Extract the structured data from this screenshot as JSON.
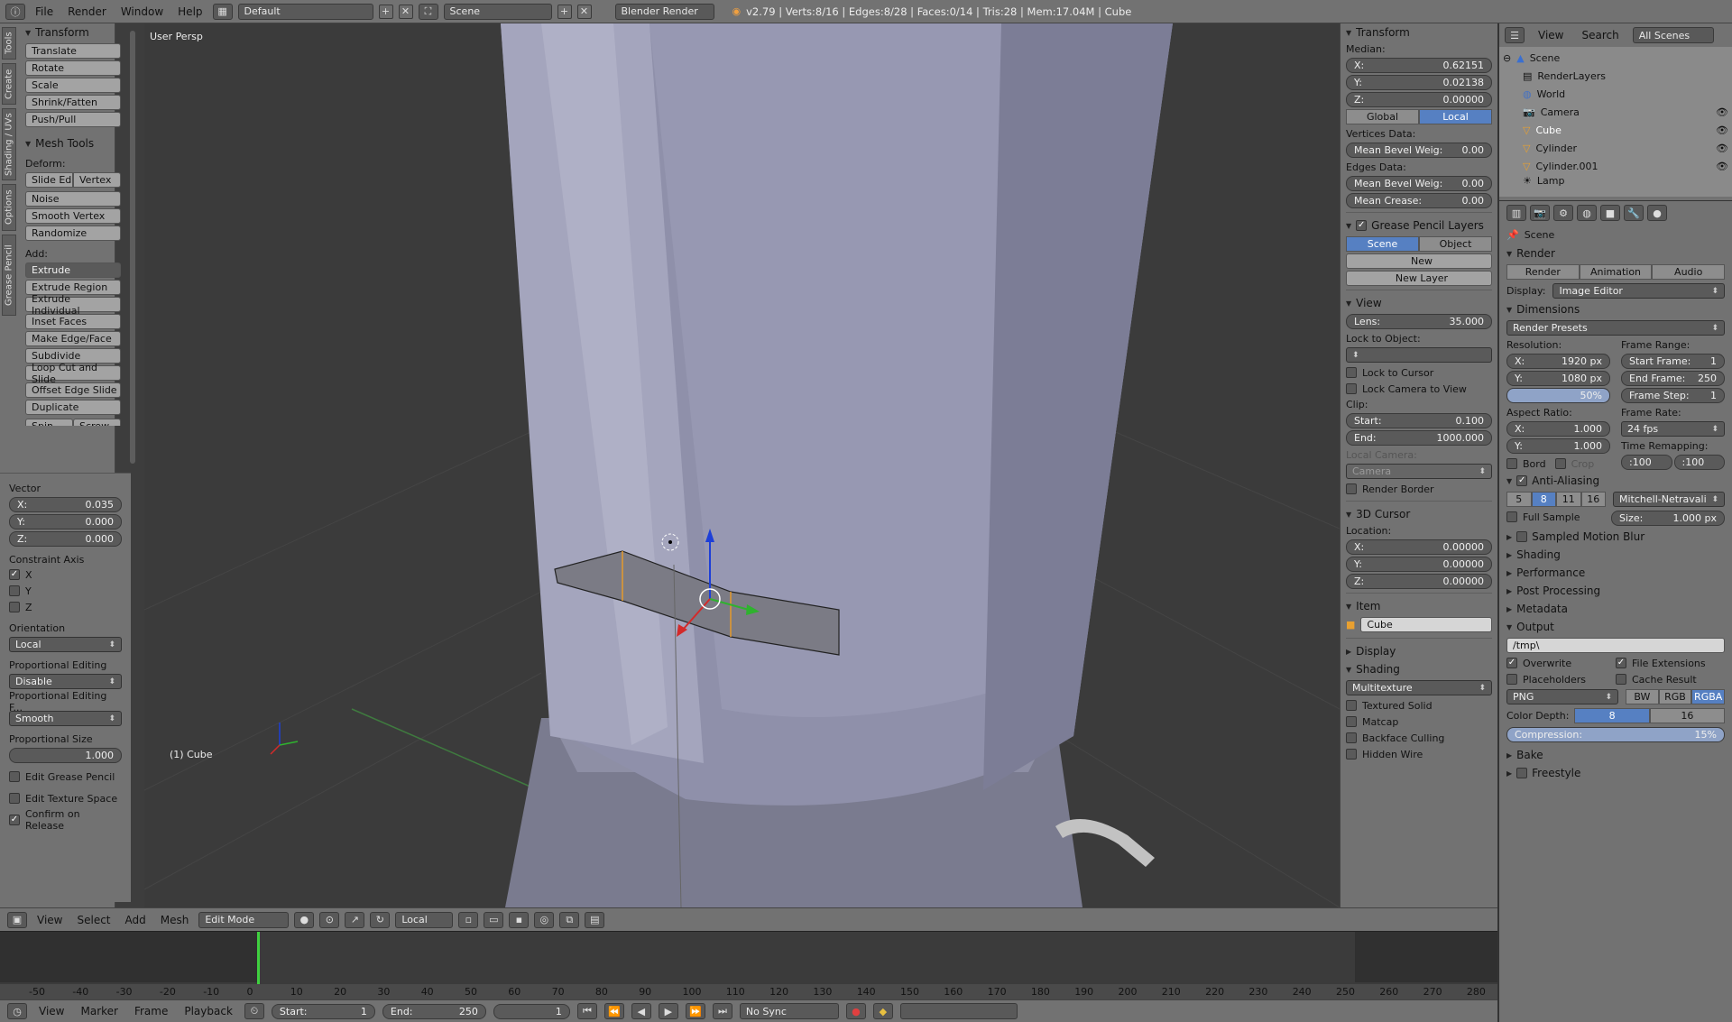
{
  "topbar": {
    "menus": [
      "File",
      "Render",
      "Window",
      "Help"
    ],
    "layout": "Default",
    "scene": "Scene",
    "engine": "Blender Render",
    "stats": "v2.79 | Verts:8/16 | Edges:8/28 | Faces:0/14 | Tris:28 | Mem:17.04M | Cube"
  },
  "tools": {
    "tabs": [
      "Tools",
      "Create",
      "Shading / UVs",
      "Options",
      "Grease Pencil"
    ],
    "transform_title": "Transform",
    "transform": [
      "Translate",
      "Rotate",
      "Scale",
      "Shrink/Fatten",
      "Push/Pull"
    ],
    "mesh_title": "Mesh Tools",
    "deform_label": "Deform:",
    "slide_edge": "Slide Ed",
    "vertex": "Vertex",
    "deform": [
      "Noise",
      "Smooth Vertex",
      "Randomize"
    ],
    "add_label": "Add:",
    "extrude": "Extrude",
    "add": [
      "Extrude Region",
      "Extrude Individual",
      "Inset Faces",
      "Make Edge/Face",
      "Subdivide",
      "Loop Cut and Slide",
      "Offset Edge Slide",
      "Duplicate"
    ],
    "spin": "Spin",
    "screw": "Screw"
  },
  "operator": {
    "vector_label": "Vector",
    "vx": "X:",
    "vxv": "0.035",
    "vy": "Y:",
    "vyv": "0.000",
    "vz": "Z:",
    "vzv": "0.000",
    "constraint_label": "Constraint Axis",
    "cx": "X",
    "cy": "Y",
    "cz": "Z",
    "orientation_label": "Orientation",
    "orientation": "Local",
    "prop_edit_label": "Proportional Editing",
    "prop_edit": "Disable",
    "prop_falloff_label": "Proportional Editing F...",
    "prop_falloff": "Smooth",
    "prop_size_label": "Proportional Size",
    "prop_size": "1.000",
    "edit_gp": "Edit Grease Pencil",
    "edit_tex": "Edit Texture Space",
    "confirm": "Confirm on Release"
  },
  "viewport": {
    "persp": "User Persp",
    "object": "(1) Cube"
  },
  "vp_header": {
    "menus": [
      "View",
      "Select",
      "Add",
      "Mesh"
    ],
    "mode": "Edit Mode",
    "orientation": "Local"
  },
  "npanel": {
    "transform_title": "Transform",
    "median": "Median:",
    "x": "X:",
    "xv": "0.62151",
    "y": "Y:",
    "yv": "0.02138",
    "z": "Z:",
    "zv": "0.00000",
    "global": "Global",
    "local": "Local",
    "vdata": "Vertices Data:",
    "mbw": "Mean Bevel Weig:",
    "mbwv": "0.00",
    "edata": "Edges Data:",
    "mbw2v": "0.00",
    "crease": "Mean Crease:",
    "creasev": "0.00",
    "gp_title": "Grease Pencil Layers",
    "gp_scene": "Scene",
    "gp_object": "Object",
    "gp_new": "New",
    "gp_newlayer": "New Layer",
    "view_title": "View",
    "lens": "Lens:",
    "lensv": "35.000",
    "lock_obj": "Lock to Object:",
    "lock_cursor": "Lock to Cursor",
    "lock_cam": "Lock Camera to View",
    "clip": "Clip:",
    "start": "Start:",
    "startv": "0.100",
    "end": "End:",
    "endv": "1000.000",
    "local_cam": "Local Camera:",
    "camera": "Camera",
    "render_border": "Render Border",
    "cursor_title": "3D Cursor",
    "location": "Location:",
    "cxv": "0.00000",
    "cyv": "0.00000",
    "czv": "0.00000",
    "item_title": "Item",
    "item_name": "Cube",
    "display_title": "Display",
    "shading_title": "Shading",
    "shading_mode": "Multitexture",
    "textured_solid": "Textured Solid",
    "matcap": "Matcap",
    "backface": "Backface Culling",
    "hidden_wire": "Hidden Wire"
  },
  "outliner": {
    "view": "View",
    "search": "Search",
    "all_scenes": "All Scenes",
    "items": [
      "Scene",
      "RenderLayers",
      "World",
      "Camera",
      "Cube",
      "Cylinder",
      "Cylinder.001",
      "Lamp"
    ]
  },
  "props": {
    "scene": "Scene",
    "render_title": "Render",
    "render_btn": "Render",
    "animation_btn": "Animation",
    "audio_btn": "Audio",
    "display_label": "Display:",
    "display": "Image Editor",
    "dim_title": "Dimensions",
    "presets": "Render Presets",
    "resolution": "Resolution:",
    "rx": "X:",
    "rxv": "1920 px",
    "ry": "Y:",
    "ryv": "1080 px",
    "pct": "50%",
    "frame_range": "Frame Range:",
    "sf": "Start Frame:",
    "sfv": "1",
    "ef": "End Frame:",
    "efv": "250",
    "fs": "Frame Step:",
    "fsv": "1",
    "aspect": "Aspect Ratio:",
    "ax": "X:",
    "axv": "1.000",
    "ay": "Y:",
    "ayv": "1.000",
    "frame_rate": "Frame Rate:",
    "fps": "24 fps",
    "bord": "Bord",
    "crop": "Crop",
    "time_remap": "Time Remapping:",
    "tr1": ":100",
    "tr2": ":100",
    "aa_title": "Anti-Aliasing",
    "aa": [
      "5",
      "8",
      "11",
      "16"
    ],
    "filter": "Mitchell-Netravali",
    "full_sample": "Full Sample",
    "size": "Size:",
    "sizev": "1.000 px",
    "collapsed": [
      "Sampled Motion Blur",
      "Shading",
      "Performance",
      "Post Processing",
      "Metadata"
    ],
    "output_title": "Output",
    "path": "/tmp\\",
    "overwrite": "Overwrite",
    "file_ext": "File Extensions",
    "placeholders": "Placeholders",
    "cache": "Cache Result",
    "format": "PNG",
    "bw": "BW",
    "rgb": "RGB",
    "rgba": "RGBA",
    "depth_label": "Color Depth:",
    "d8": "8",
    "d16": "16",
    "compression": "Compression:",
    "compv": "15%",
    "bake": "Bake",
    "freestyle": "Freestyle"
  },
  "timeline": {
    "ticks": [
      "-50",
      "-40",
      "-30",
      "-20",
      "-10",
      "0",
      "10",
      "20",
      "30",
      "40",
      "50",
      "60",
      "70",
      "80",
      "90",
      "100",
      "110",
      "120",
      "130",
      "140",
      "150",
      "160",
      "170",
      "180",
      "190",
      "200",
      "210",
      "220",
      "230",
      "240",
      "250",
      "260",
      "270",
      "280"
    ],
    "menus": [
      "View",
      "Marker",
      "Frame",
      "Playback"
    ],
    "start": "Start:",
    "startv": "1",
    "end": "End:",
    "endv": "250",
    "current": "1",
    "sync": "No Sync"
  }
}
